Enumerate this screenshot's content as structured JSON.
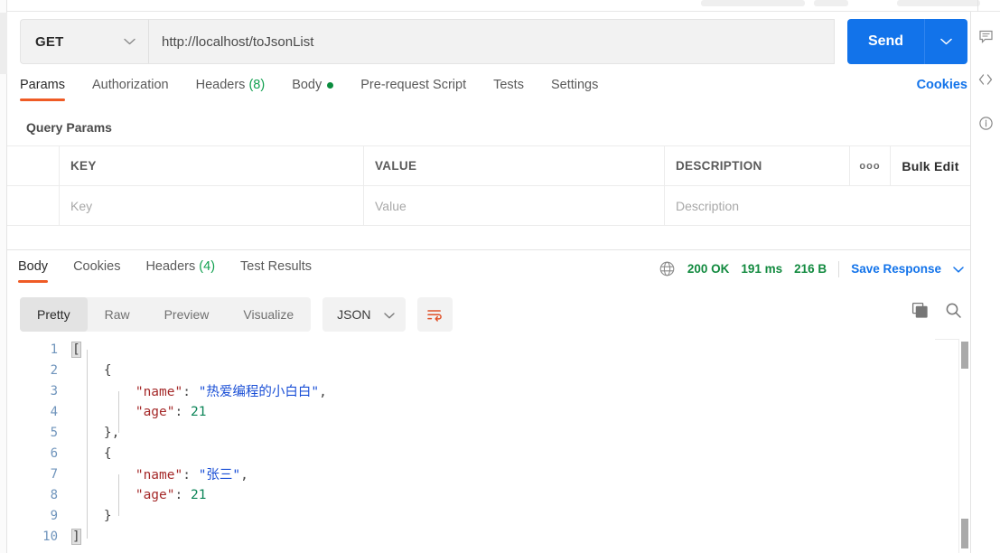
{
  "request": {
    "method": "GET",
    "url": "http://localhost/toJsonList",
    "send_label": "Send",
    "send_caret_icon": "chevron-down-icon",
    "method_caret_icon": "chevron-down-icon",
    "tabs": [
      {
        "label": "Params",
        "active": true
      },
      {
        "label": "Authorization",
        "active": false
      },
      {
        "label": "Headers",
        "count": "(8)",
        "active": false
      },
      {
        "label": "Body",
        "dot": true,
        "active": false
      },
      {
        "label": "Pre-request Script",
        "active": false
      },
      {
        "label": "Tests",
        "active": false
      },
      {
        "label": "Settings",
        "active": false
      }
    ],
    "cookies_link": "Cookies"
  },
  "query_params": {
    "title": "Query Params",
    "columns": [
      "KEY",
      "VALUE",
      "DESCRIPTION"
    ],
    "dots_icon": "ooo",
    "bulk_edit_label": "Bulk Edit",
    "rows": [
      {
        "key_placeholder": "Key",
        "value_placeholder": "Value",
        "description_placeholder": "Description"
      }
    ]
  },
  "response": {
    "tabs": [
      {
        "label": "Body",
        "active": true
      },
      {
        "label": "Cookies",
        "active": false
      },
      {
        "label": "Headers",
        "count": "(4)",
        "active": false
      },
      {
        "label": "Test Results",
        "active": false
      }
    ],
    "status": {
      "globe_icon": "globe-icon",
      "code": "200 OK",
      "time": "191 ms",
      "size": "216 B",
      "save_label": "Save Response",
      "save_caret_icon": "chevron-down-icon"
    },
    "viewer": {
      "modes": [
        {
          "label": "Pretty",
          "active": true
        },
        {
          "label": "Raw",
          "active": false
        },
        {
          "label": "Preview",
          "active": false
        },
        {
          "label": "Visualize",
          "active": false
        }
      ],
      "format": "JSON",
      "format_caret_icon": "chevron-down-icon",
      "wrap_icon": "word-wrap-icon",
      "copy_icon": "copy-icon",
      "search_icon": "search-icon"
    },
    "body_lines": [
      {
        "num": "1",
        "segments": [
          {
            "t": "[",
            "c": "brk"
          }
        ]
      },
      {
        "num": "2",
        "segments": [
          {
            "t": "    {",
            "c": "p"
          }
        ]
      },
      {
        "num": "3",
        "segments": [
          {
            "t": "        ",
            "c": "p"
          },
          {
            "t": "\"name\"",
            "c": "k"
          },
          {
            "t": ": ",
            "c": "p"
          },
          {
            "t": "\"热爱编程的小白白\"",
            "c": "s"
          },
          {
            "t": ",",
            "c": "p"
          }
        ]
      },
      {
        "num": "4",
        "segments": [
          {
            "t": "        ",
            "c": "p"
          },
          {
            "t": "\"age\"",
            "c": "k"
          },
          {
            "t": ": ",
            "c": "p"
          },
          {
            "t": "21",
            "c": "n"
          }
        ]
      },
      {
        "num": "5",
        "segments": [
          {
            "t": "    },",
            "c": "p"
          }
        ]
      },
      {
        "num": "6",
        "segments": [
          {
            "t": "    {",
            "c": "p"
          }
        ]
      },
      {
        "num": "7",
        "segments": [
          {
            "t": "        ",
            "c": "p"
          },
          {
            "t": "\"name\"",
            "c": "k"
          },
          {
            "t": ": ",
            "c": "p"
          },
          {
            "t": "\"张三\"",
            "c": "s"
          },
          {
            "t": ",",
            "c": "p"
          }
        ]
      },
      {
        "num": "8",
        "segments": [
          {
            "t": "        ",
            "c": "p"
          },
          {
            "t": "\"age\"",
            "c": "k"
          },
          {
            "t": ": ",
            "c": "p"
          },
          {
            "t": "21",
            "c": "n"
          }
        ]
      },
      {
        "num": "9",
        "segments": [
          {
            "t": "    }",
            "c": "p"
          }
        ]
      },
      {
        "num": "10",
        "segments": [
          {
            "t": "]",
            "c": "brk"
          }
        ]
      }
    ]
  },
  "right_rail": [
    {
      "icon": "comment-icon"
    },
    {
      "icon": "code-icon"
    },
    {
      "icon": "info-icon"
    }
  ],
  "colors": {
    "accent_orange": "#ef5b25",
    "primary_blue": "#1273ea",
    "success_green": "#128a3f",
    "json_key": "#a52a2a",
    "json_string": "#1a4fd6",
    "json_number": "#0b8457"
  }
}
